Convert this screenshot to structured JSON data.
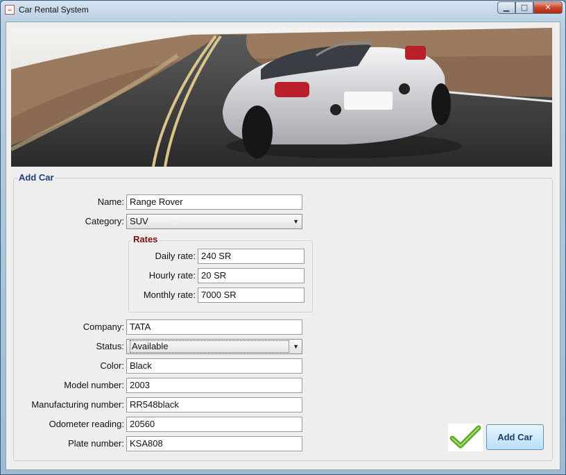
{
  "window": {
    "title": "Car Rental System",
    "minimize_glyph": "▁",
    "maximize_glyph": "□",
    "close_glyph": "✕",
    "app_icon": "java-cup-icon"
  },
  "banner": {
    "image": "sports-car-on-road"
  },
  "form": {
    "panel_title": "Add Car",
    "name": {
      "label": "Name:",
      "value": "Range Rover"
    },
    "category": {
      "label": "Category:",
      "value": "SUV"
    },
    "rates": {
      "title": "Rates",
      "daily": {
        "label": "Daily rate:",
        "value": "240 SR"
      },
      "hourly": {
        "label": "Hourly rate:",
        "value": "20 SR"
      },
      "monthly": {
        "label": "Monthly rate:",
        "value": "7000 SR"
      }
    },
    "company": {
      "label": "Company:",
      "value": "TATA"
    },
    "status": {
      "label": "Status:",
      "value": "Available"
    },
    "color": {
      "label": "Color:",
      "value": "Black"
    },
    "model_number": {
      "label": "Model number:",
      "value": "2003"
    },
    "manufacturing_number": {
      "label": "Manufacturing number:",
      "value": "RR548black"
    },
    "odometer": {
      "label": "Odometer reading:",
      "value": "20560"
    },
    "plate": {
      "label": "Plate number:",
      "value": "KSA808"
    }
  },
  "actions": {
    "confirm_icon": "green-checkmark-icon",
    "add_label": "Add Car"
  }
}
